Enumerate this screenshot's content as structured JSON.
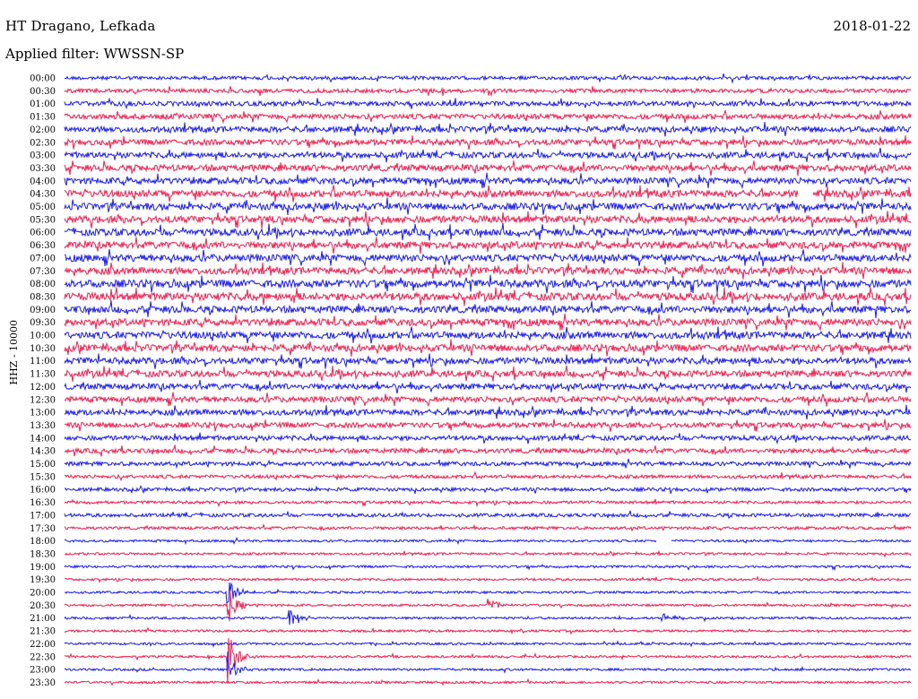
{
  "header": {
    "station": "HT Dragano, Lefkada",
    "date": "2018-01-22",
    "filter": "Applied filter: WWSSN-SP",
    "channel_label": "HHZ - 10000"
  },
  "colors": {
    "odd": "#1a1aff",
    "even": "#ff1a4d",
    "background": "#ffffff"
  },
  "chart_data": {
    "type": "line",
    "title": "HT Dragano, Lefkada",
    "subtitle": "Applied filter: WWSSN-SP",
    "ylabel": "HHZ - 10000",
    "xlabel": "",
    "row_labels": [
      "00:00",
      "00:30",
      "01:00",
      "01:30",
      "02:00",
      "02:30",
      "03:00",
      "03:30",
      "04:00",
      "04:30",
      "05:00",
      "05:30",
      "06:00",
      "06:30",
      "07:00",
      "07:30",
      "08:00",
      "08:30",
      "09:00",
      "09:30",
      "10:00",
      "10:30",
      "11:00",
      "11:30",
      "12:00",
      "12:30",
      "13:00",
      "13:30",
      "14:00",
      "14:30",
      "15:00",
      "15:30",
      "16:00",
      "16:30",
      "17:00",
      "17:30",
      "18:00",
      "18:30",
      "19:00",
      "19:30",
      "20:00",
      "20:30",
      "21:00",
      "21:30",
      "22:00",
      "22:30",
      "23:00",
      "23:30"
    ],
    "row_noise_level": [
      0.6,
      0.7,
      0.8,
      0.9,
      1.0,
      1.0,
      1.0,
      1.1,
      1.1,
      1.2,
      1.2,
      1.2,
      1.2,
      1.2,
      1.2,
      1.2,
      1.3,
      1.3,
      1.2,
      1.2,
      1.2,
      1.2,
      1.1,
      1.1,
      1.0,
      1.0,
      1.0,
      0.9,
      0.8,
      0.8,
      0.7,
      0.6,
      0.6,
      0.5,
      0.6,
      0.5,
      0.4,
      0.4,
      0.4,
      0.4,
      0.4,
      0.4,
      0.4,
      0.4,
      0.4,
      0.4,
      0.4,
      0.4
    ],
    "events": [
      {
        "row": "20:00",
        "x_min": 5.8,
        "amplitude": 2.5
      },
      {
        "row": "20:30",
        "x_min": 5.8,
        "amplitude": 3.0
      },
      {
        "row": "21:00",
        "x_min": 8.0,
        "amplitude": 2.0
      },
      {
        "row": "20:30",
        "x_min": 15.0,
        "amplitude": 1.2
      },
      {
        "row": "21:00",
        "x_min": 21.2,
        "amplitude": 1.0
      },
      {
        "row": "22:30",
        "x_min": 5.8,
        "amplitude": 4.5
      },
      {
        "row": "23:00",
        "x_min": 5.8,
        "amplitude": 3.0
      }
    ],
    "gaps": [
      {
        "row": "04:30",
        "x_min": 26.0
      },
      {
        "row": "18:00",
        "x_min": 21.0
      }
    ],
    "x_range_minutes": [
      0,
      30
    ]
  }
}
